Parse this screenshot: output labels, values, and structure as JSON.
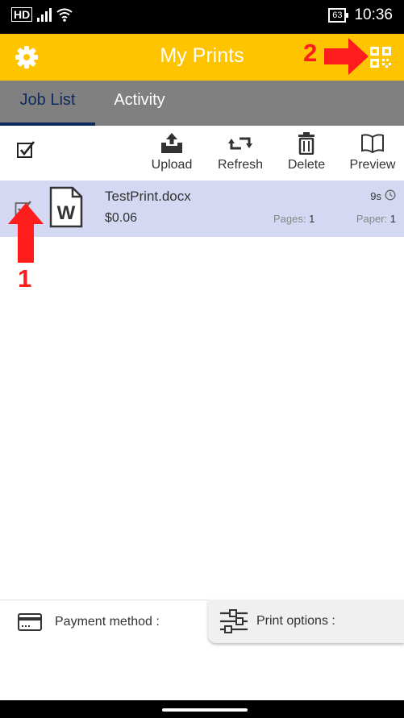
{
  "status_bar": {
    "network": "HD",
    "battery": "63",
    "time": "10:36"
  },
  "header": {
    "title": "My Prints",
    "settings_icon": "gear-icon",
    "qr_icon": "qr-code-icon"
  },
  "annotations": {
    "arrow_2_label": "2",
    "arrow_1_label": "1"
  },
  "tabs": [
    {
      "label": "Job List",
      "active": true
    },
    {
      "label": "Activity",
      "active": false
    }
  ],
  "toolbar": {
    "upload_label": "Upload",
    "refresh_label": "Refresh",
    "delete_label": "Delete",
    "preview_label": "Preview"
  },
  "job": {
    "name": "TestPrint.docx",
    "price": "$0.06",
    "time": "9s",
    "pages_label": "Pages:",
    "pages_value": "1",
    "paper_label": "Paper:",
    "paper_value": "1",
    "selected": true
  },
  "bottom": {
    "payment_label": "Payment method :",
    "print_options_label": "Print options :"
  },
  "colors": {
    "header": "#ffc400",
    "tabs": "#808080",
    "active_tab": "#0e2a5e",
    "selected_row": "#d4d8f2",
    "annotation": "#ff1c1c"
  }
}
